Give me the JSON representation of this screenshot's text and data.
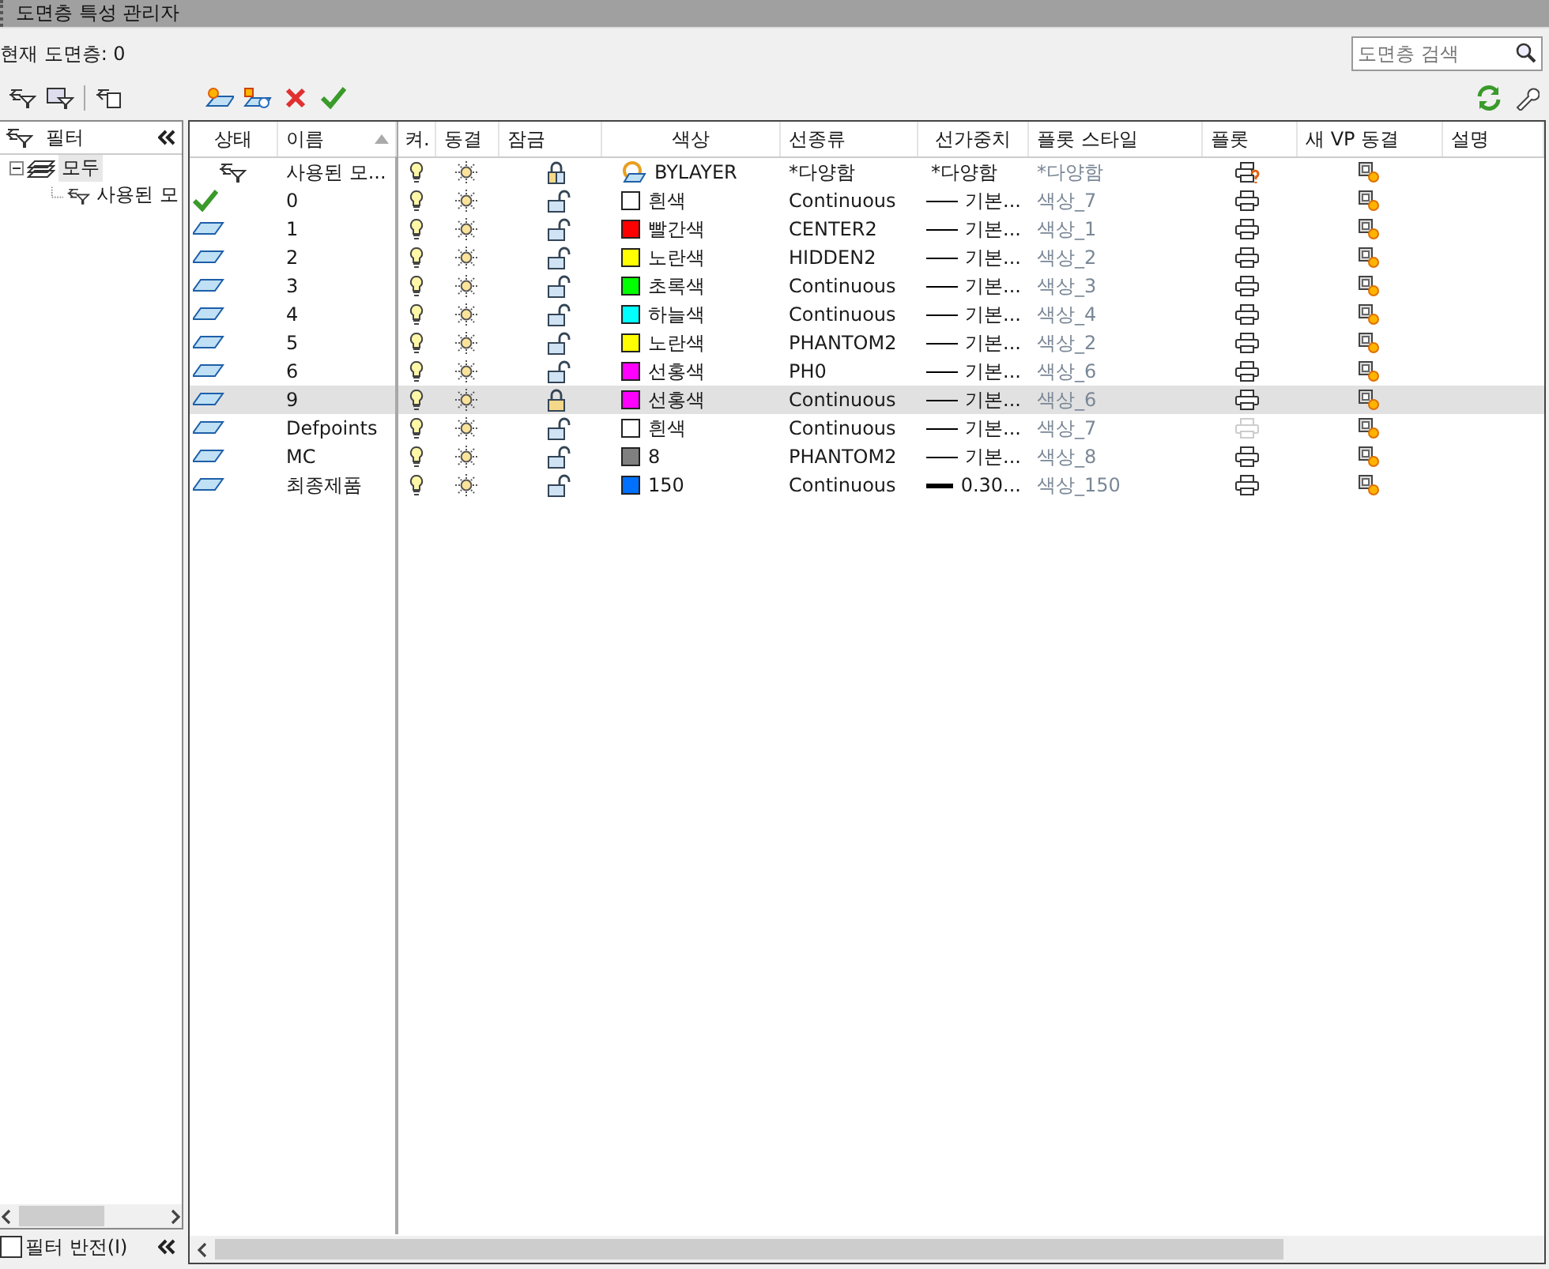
{
  "title": "도면층 특성 관리자",
  "current_layer": "현재 도면층: 0",
  "search": {
    "placeholder": "도면층 검색"
  },
  "filters": {
    "header": "필터",
    "tree": [
      {
        "label": "모두",
        "expanded": true,
        "selected": true,
        "children": [
          {
            "label": "사용된 모",
            "selected": false
          }
        ]
      }
    ],
    "invert": {
      "label": "필터 반전(I)",
      "checked": false
    }
  },
  "columns": [
    "상태",
    "이름",
    "켜.",
    "동결",
    "잠금",
    "색상",
    "선종류",
    "선가중치",
    "플롯 스타일",
    "플롯",
    "새 VP 동결",
    "설명"
  ],
  "rows": [
    {
      "kind": "filter",
      "name": "사용된 모...",
      "on": true,
      "frozen": false,
      "lock": {
        "kind": "mixed"
      },
      "color": {
        "kind": "bylayer",
        "label": "BYLAYER"
      },
      "linetype": "*다양함",
      "lineweight": {
        "kind": "none",
        "text": "*다양함"
      },
      "plot_style": "*다양함",
      "plot": {
        "kind": "mixed"
      },
      "selected": false
    },
    {
      "kind": "current",
      "name": "0",
      "on": true,
      "frozen": false,
      "lock": {
        "kind": "open"
      },
      "color": {
        "kind": "swatch",
        "color": "#ffffff",
        "label": "흰색"
      },
      "linetype": "Continuous",
      "lineweight": {
        "kind": "thin",
        "text": "기본..."
      },
      "plot_style": "색상_7",
      "plot": {
        "kind": "on"
      },
      "selected": false
    },
    {
      "kind": "layer",
      "name": "1",
      "on": true,
      "frozen": false,
      "lock": {
        "kind": "open"
      },
      "color": {
        "kind": "swatch",
        "color": "#ff0000",
        "label": "빨간색"
      },
      "linetype": "CENTER2",
      "lineweight": {
        "kind": "thin",
        "text": "기본..."
      },
      "plot_style": "색상_1",
      "plot": {
        "kind": "on"
      },
      "selected": false
    },
    {
      "kind": "layer",
      "name": "2",
      "on": true,
      "frozen": false,
      "lock": {
        "kind": "open"
      },
      "color": {
        "kind": "swatch",
        "color": "#ffff00",
        "label": "노란색"
      },
      "linetype": "HIDDEN2",
      "lineweight": {
        "kind": "thin",
        "text": "기본..."
      },
      "plot_style": "색상_2",
      "plot": {
        "kind": "on"
      },
      "selected": false
    },
    {
      "kind": "layer",
      "name": "3",
      "on": true,
      "frozen": false,
      "lock": {
        "kind": "open"
      },
      "color": {
        "kind": "swatch",
        "color": "#00ff00",
        "label": "초록색"
      },
      "linetype": "Continuous",
      "lineweight": {
        "kind": "thin",
        "text": "기본..."
      },
      "plot_style": "색상_3",
      "plot": {
        "kind": "on"
      },
      "selected": false
    },
    {
      "kind": "layer",
      "name": "4",
      "on": true,
      "frozen": false,
      "lock": {
        "kind": "open"
      },
      "color": {
        "kind": "swatch",
        "color": "#00ffff",
        "label": "하늘색"
      },
      "linetype": "Continuous",
      "lineweight": {
        "kind": "thin",
        "text": "기본..."
      },
      "plot_style": "색상_4",
      "plot": {
        "kind": "on"
      },
      "selected": false
    },
    {
      "kind": "layer",
      "name": "5",
      "on": true,
      "frozen": false,
      "lock": {
        "kind": "open"
      },
      "color": {
        "kind": "swatch",
        "color": "#ffff00",
        "label": "노란색"
      },
      "linetype": "PHANTOM2",
      "lineweight": {
        "kind": "thin",
        "text": "기본..."
      },
      "plot_style": "색상_2",
      "plot": {
        "kind": "on"
      },
      "selected": false
    },
    {
      "kind": "layer",
      "name": "6",
      "on": true,
      "frozen": false,
      "lock": {
        "kind": "open"
      },
      "color": {
        "kind": "swatch",
        "color": "#ff00ff",
        "label": "선홍색"
      },
      "linetype": "PH0",
      "lineweight": {
        "kind": "thin",
        "text": "기본..."
      },
      "plot_style": "색상_6",
      "plot": {
        "kind": "on"
      },
      "selected": false
    },
    {
      "kind": "layer",
      "name": "9",
      "on": true,
      "frozen": false,
      "lock": {
        "kind": "closed"
      },
      "color": {
        "kind": "swatch",
        "color": "#ff00ff",
        "label": "선홍색"
      },
      "linetype": "Continuous",
      "lineweight": {
        "kind": "thin",
        "text": "기본..."
      },
      "plot_style": "색상_6",
      "plot": {
        "kind": "on"
      },
      "selected": true
    },
    {
      "kind": "layer",
      "name": "Defpoints",
      "on": true,
      "frozen": false,
      "lock": {
        "kind": "open"
      },
      "color": {
        "kind": "swatch",
        "color": "#ffffff",
        "label": "흰색"
      },
      "linetype": "Continuous",
      "lineweight": {
        "kind": "thin",
        "text": "기본..."
      },
      "plot_style": "색상_7",
      "plot": {
        "kind": "off"
      },
      "selected": false
    },
    {
      "kind": "layer",
      "name": "MC",
      "on": true,
      "frozen": false,
      "lock": {
        "kind": "open"
      },
      "color": {
        "kind": "swatch",
        "color": "#808080",
        "label": "8"
      },
      "linetype": "PHANTOM2",
      "lineweight": {
        "kind": "thin",
        "text": "기본..."
      },
      "plot_style": "색상_8",
      "plot": {
        "kind": "on"
      },
      "selected": false
    },
    {
      "kind": "layer",
      "name": "최종제품",
      "on": true,
      "frozen": false,
      "lock": {
        "kind": "open"
      },
      "color": {
        "kind": "swatch",
        "color": "#0070ff",
        "label": "150"
      },
      "linetype": "Continuous",
      "lineweight": {
        "kind": "thick",
        "text": "0.30..."
      },
      "plot_style": "색상_150",
      "plot": {
        "kind": "on"
      },
      "selected": false
    }
  ]
}
